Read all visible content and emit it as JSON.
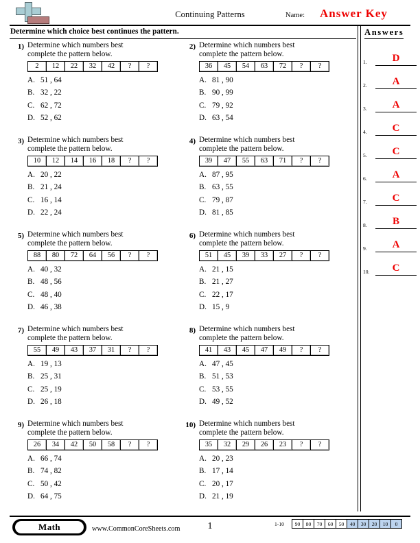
{
  "header": {
    "title": "Continuing Patterns",
    "name_label": "Name:",
    "answer_key_text": "Answer Key",
    "logo_colors": {
      "plus": "#a9cdd4",
      "rect": "#b57b7b"
    }
  },
  "instructions": "Determine which choice best continues the pattern.",
  "question_prompt_line1": "Determine which numbers best",
  "question_prompt_line2": "complete the pattern below.",
  "problems": [
    {
      "number": "1)",
      "prompt_line1": "Determine which numbers best",
      "prompt_line2": "complete the pattern below.",
      "sequence": [
        "2",
        "12",
        "22",
        "32",
        "42",
        "?",
        "?"
      ],
      "choices": [
        {
          "letter": "A.",
          "text": "51 , 64"
        },
        {
          "letter": "B.",
          "text": "32 , 22"
        },
        {
          "letter": "C.",
          "text": "62 , 72"
        },
        {
          "letter": "D.",
          "text": "52 , 62"
        }
      ]
    },
    {
      "number": "2)",
      "prompt_line1": "Determine which numbers best",
      "prompt_line2": "complete the pattern below.",
      "sequence": [
        "36",
        "45",
        "54",
        "63",
        "72",
        "?",
        "?"
      ],
      "choices": [
        {
          "letter": "A.",
          "text": "81 , 90"
        },
        {
          "letter": "B.",
          "text": "90 , 99"
        },
        {
          "letter": "C.",
          "text": "79 , 92"
        },
        {
          "letter": "D.",
          "text": "63 , 54"
        }
      ]
    },
    {
      "number": "3)",
      "prompt_line1": "Determine which numbers best",
      "prompt_line2": "complete the pattern below.",
      "sequence": [
        "10",
        "12",
        "14",
        "16",
        "18",
        "?",
        "?"
      ],
      "choices": [
        {
          "letter": "A.",
          "text": "20 , 22"
        },
        {
          "letter": "B.",
          "text": "21 , 24"
        },
        {
          "letter": "C.",
          "text": "16 , 14"
        },
        {
          "letter": "D.",
          "text": "22 , 24"
        }
      ]
    },
    {
      "number": "4)",
      "prompt_line1": "Determine which numbers best",
      "prompt_line2": "complete the pattern below.",
      "sequence": [
        "39",
        "47",
        "55",
        "63",
        "71",
        "?",
        "?"
      ],
      "choices": [
        {
          "letter": "A.",
          "text": "87 , 95"
        },
        {
          "letter": "B.",
          "text": "63 , 55"
        },
        {
          "letter": "C.",
          "text": "79 , 87"
        },
        {
          "letter": "D.",
          "text": "81 , 85"
        }
      ]
    },
    {
      "number": "5)",
      "prompt_line1": "Determine which numbers best",
      "prompt_line2": "complete the pattern below.",
      "sequence": [
        "88",
        "80",
        "72",
        "64",
        "56",
        "?",
        "?"
      ],
      "choices": [
        {
          "letter": "A.",
          "text": "40 , 32"
        },
        {
          "letter": "B.",
          "text": "48 , 56"
        },
        {
          "letter": "C.",
          "text": "48 , 40"
        },
        {
          "letter": "D.",
          "text": "46 , 38"
        }
      ]
    },
    {
      "number": "6)",
      "prompt_line1": "Determine which numbers best",
      "prompt_line2": "complete the pattern below.",
      "sequence": [
        "51",
        "45",
        "39",
        "33",
        "27",
        "?",
        "?"
      ],
      "choices": [
        {
          "letter": "A.",
          "text": "21 , 15"
        },
        {
          "letter": "B.",
          "text": "21 , 27"
        },
        {
          "letter": "C.",
          "text": "22 , 17"
        },
        {
          "letter": "D.",
          "text": "15 , 9"
        }
      ]
    },
    {
      "number": "7)",
      "prompt_line1": "Determine which numbers best",
      "prompt_line2": "complete the pattern below.",
      "sequence": [
        "55",
        "49",
        "43",
        "37",
        "31",
        "?",
        "?"
      ],
      "choices": [
        {
          "letter": "A.",
          "text": "19 , 13"
        },
        {
          "letter": "B.",
          "text": "25 , 31"
        },
        {
          "letter": "C.",
          "text": "25 , 19"
        },
        {
          "letter": "D.",
          "text": "26 , 18"
        }
      ]
    },
    {
      "number": "8)",
      "prompt_line1": "Determine which numbers best",
      "prompt_line2": "complete the pattern below.",
      "sequence": [
        "41",
        "43",
        "45",
        "47",
        "49",
        "?",
        "?"
      ],
      "choices": [
        {
          "letter": "A.",
          "text": "47 , 45"
        },
        {
          "letter": "B.",
          "text": "51 , 53"
        },
        {
          "letter": "C.",
          "text": "53 , 55"
        },
        {
          "letter": "D.",
          "text": "49 , 52"
        }
      ]
    },
    {
      "number": "9)",
      "prompt_line1": "Determine which numbers best",
      "prompt_line2": "complete the pattern below.",
      "sequence": [
        "26",
        "34",
        "42",
        "50",
        "58",
        "?",
        "?"
      ],
      "choices": [
        {
          "letter": "A.",
          "text": "66 , 74"
        },
        {
          "letter": "B.",
          "text": "74 , 82"
        },
        {
          "letter": "C.",
          "text": "50 , 42"
        },
        {
          "letter": "D.",
          "text": "64 , 75"
        }
      ]
    },
    {
      "number": "10)",
      "prompt_line1": "Determine which numbers best",
      "prompt_line2": "complete the pattern below.",
      "sequence": [
        "35",
        "32",
        "29",
        "26",
        "23",
        "?",
        "?"
      ],
      "choices": [
        {
          "letter": "A.",
          "text": "20 , 23"
        },
        {
          "letter": "B.",
          "text": "17 , 14"
        },
        {
          "letter": "C.",
          "text": "20 , 17"
        },
        {
          "letter": "D.",
          "text": "21 , 19"
        }
      ]
    }
  ],
  "answers_panel": {
    "heading": "Answers",
    "answer_color": "#ee0000",
    "rows": [
      {
        "index": "1.",
        "value": "D"
      },
      {
        "index": "2.",
        "value": "A"
      },
      {
        "index": "3.",
        "value": "A"
      },
      {
        "index": "4.",
        "value": "C"
      },
      {
        "index": "5.",
        "value": "C"
      },
      {
        "index": "6.",
        "value": "A"
      },
      {
        "index": "7.",
        "value": "C"
      },
      {
        "index": "8.",
        "value": "B"
      },
      {
        "index": "9.",
        "value": "A"
      },
      {
        "index": "10.",
        "value": "C"
      }
    ]
  },
  "footer": {
    "subject_badge": "Math",
    "site_url": "www.CommonCoreSheets.com",
    "page_number": "1",
    "scale_label": "1-10",
    "scale_values": [
      "90",
      "80",
      "70",
      "60",
      "50",
      "40",
      "30",
      "20",
      "10",
      "0"
    ],
    "scale_highlighted": [
      "40",
      "30",
      "20",
      "10",
      "0"
    ],
    "scale_highlight_color": "#bdd4ef"
  }
}
